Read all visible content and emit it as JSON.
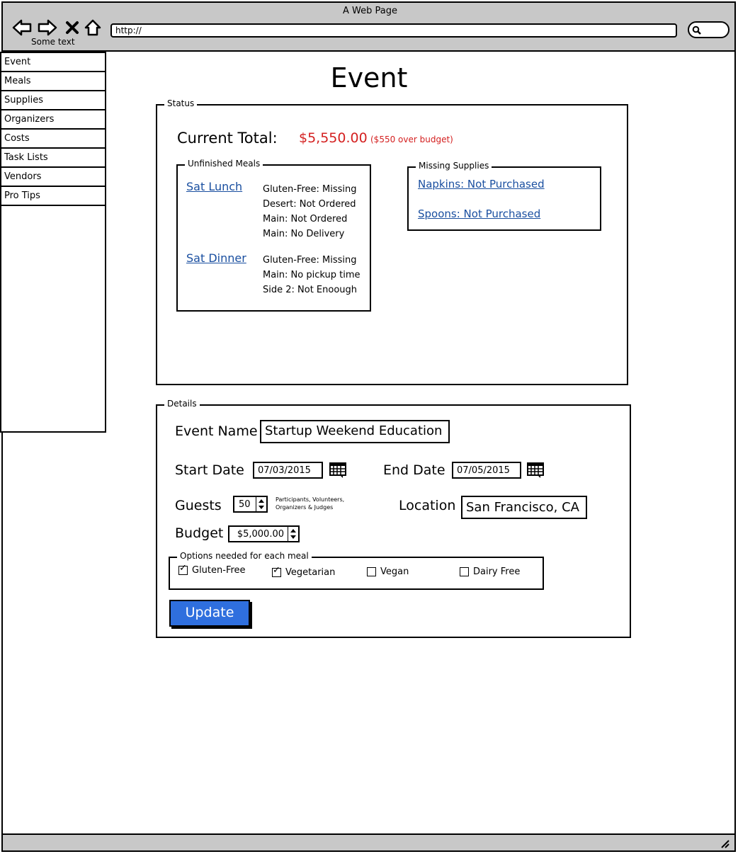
{
  "browser": {
    "title": "A Web Page",
    "nav_label": "Some text",
    "url": "http://"
  },
  "sidebar": {
    "items": [
      {
        "label": "Event"
      },
      {
        "label": "Meals"
      },
      {
        "label": "Supplies"
      },
      {
        "label": "Organizers"
      },
      {
        "label": "Costs"
      },
      {
        "label": "Task Lists"
      },
      {
        "label": "Vendors"
      },
      {
        "label": "Pro Tips"
      }
    ]
  },
  "page": {
    "title": "Event"
  },
  "status": {
    "legend": "Status",
    "total_label": "Current Total:",
    "total_value": "$5,550.00",
    "budget_note": "($550 over budget)",
    "unfinished_meals": {
      "legend": "Unfinished Meals",
      "meals": [
        {
          "name": "Sat Lunch",
          "issues": [
            "Gluten-Free: Missing",
            "Desert: Not Ordered",
            "Main: Not Ordered",
            "Main: No Delivery"
          ]
        },
        {
          "name": "Sat Dinner",
          "issues": [
            "Gluten-Free: Missing",
            "Main: No pickup time",
            "Side 2: Not Enoough"
          ]
        }
      ]
    },
    "missing_supplies": {
      "legend": "Missing Supplies",
      "items": [
        "Napkins: Not Purchased",
        "Spoons: Not Purchased"
      ]
    }
  },
  "details": {
    "legend": "Details",
    "event_name_label": "Event Name",
    "event_name_value": "Startup Weekend Education",
    "start_date_label": "Start Date",
    "start_date_value": "07/03/2015",
    "end_date_label": "End Date",
    "end_date_value": "07/05/2015",
    "guests_label": "Guests",
    "guests_value": "50",
    "guests_note_1": "Participants, Volunteers,",
    "guests_note_2": "Organizers & Judges",
    "location_label": "Location",
    "location_value": "San Francisco, CA",
    "budget_label": "Budget",
    "budget_value": "$5,000.00",
    "options": {
      "legend": "Options needed for each meal",
      "items": [
        {
          "label": "Gluten-Free",
          "checked": true
        },
        {
          "label": "Vegetarian",
          "checked": true
        },
        {
          "label": "Vegan",
          "checked": false
        },
        {
          "label": "Dairy Free",
          "checked": false
        }
      ]
    },
    "update_label": "Update"
  },
  "colors": {
    "alert_red": "#d42020",
    "link_blue": "#1a4fa0",
    "button_blue": "#2f6fde",
    "chrome_gray": "#c8c8c8"
  }
}
